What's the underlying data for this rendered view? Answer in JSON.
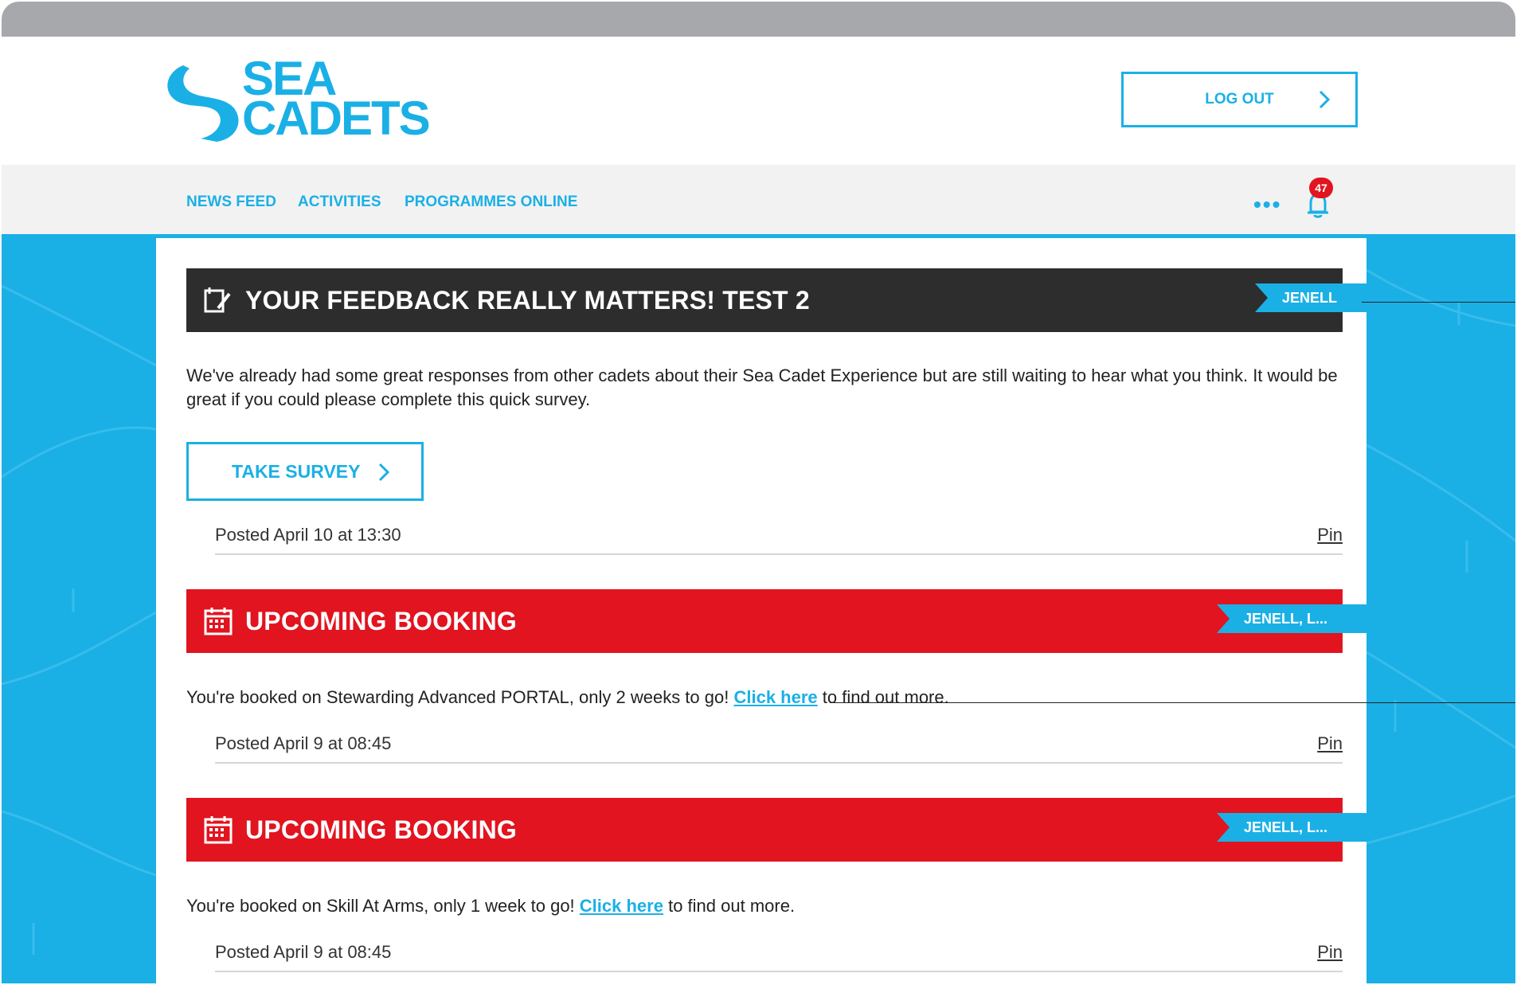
{
  "brand": {
    "logo_line1": "SEA",
    "logo_line2": "CADETS",
    "color": "#1ab0e6"
  },
  "header": {
    "logout_label": "LOG OUT"
  },
  "nav": {
    "items": [
      {
        "label": "NEWS FEED",
        "active": true
      },
      {
        "label": "ACTIVITIES",
        "active": false
      },
      {
        "label": "PROGRAMMES ONLINE",
        "active": false
      }
    ],
    "more_label": "•••",
    "notification_count": "47"
  },
  "posts": [
    {
      "type": "survey",
      "icon": "edit-icon",
      "title": "YOUR FEEDBACK REALLY MATTERS! TEST 2",
      "tag": "JENELL",
      "body": "We've already had some great responses from other cadets about their Sea Cadet Experience but are still waiting to hear what you think. It would be great if you could please complete this quick survey.",
      "button_label": "TAKE SURVEY",
      "posted": "Posted April 10 at 13:30",
      "pin_label": "Pin",
      "header_color": "#2d2d2e"
    },
    {
      "type": "booking",
      "icon": "calendar-icon",
      "title": "UPCOMING BOOKING",
      "tag": "JENELL, L...",
      "body_before": "You're booked on Stewarding Advanced PORTAL, only 2 weeks to go! ",
      "link_label": "Click here",
      "body_after": " to find out more.",
      "posted": "Posted April 9 at 08:45",
      "pin_label": "Pin",
      "header_color": "#e1141f"
    },
    {
      "type": "booking",
      "icon": "calendar-icon",
      "title": "UPCOMING BOOKING",
      "tag": "JENELL, L...",
      "body_before": "You're booked on Skill At Arms, only 1 week to go! ",
      "link_label": "Click here",
      "body_after": " to find out more.",
      "posted": "Posted April 9 at 08:45",
      "pin_label": "Pin",
      "header_color": "#e1141f"
    }
  ]
}
